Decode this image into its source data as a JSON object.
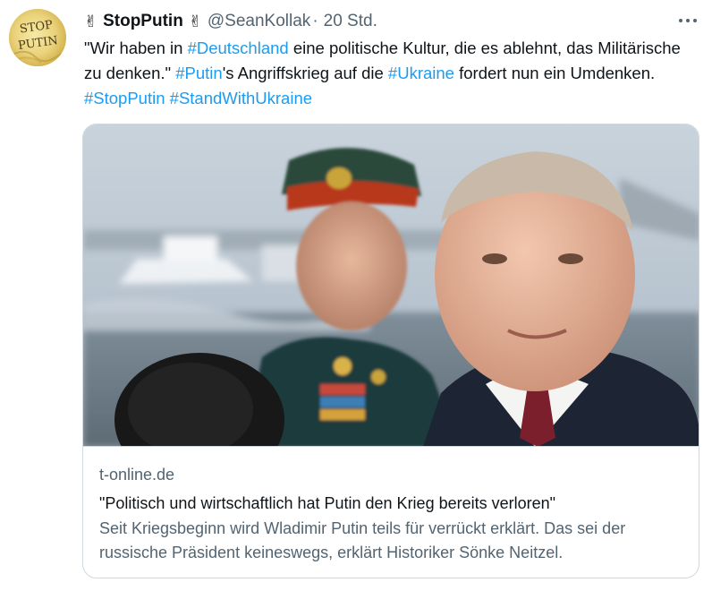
{
  "author": {
    "name": "StopPutin",
    "handle": "@SeanKollak",
    "separator": "·",
    "time": "20 Std.",
    "emoji_left": "✌",
    "emoji_right": "✌",
    "avatar_text": [
      "STOP",
      "PUTIN"
    ]
  },
  "tweet": {
    "p1": "\"Wir haben in ",
    "tag_deutschland": "#Deutschland",
    "p2": " eine politische Kultur, die es ablehnt, das Militärische zu denken.\" ",
    "tag_putin": "#Putin",
    "p3": "'s Angriffskrieg auf die ",
    "tag_ukraine": "#Ukraine",
    "p4": " fordert nun ein Umdenken. ",
    "tag_stopputin": "#StopPutin",
    "p5": " ",
    "tag_standwithukraine": "#StandWithUkraine"
  },
  "card": {
    "domain": "t-online.de",
    "title": "\"Politisch und wirtschaftlich hat Putin den Krieg bereits verloren\"",
    "description": "Seit Kriegsbeginn wird Wladimir Putin teils für verrückt erklärt. Das sei der russische Präsident keineswegs, erklärt Historiker Sönke Neitzel."
  },
  "colors": {
    "accent": "#1d9bf0",
    "text": "#0f1419",
    "secondary": "#536471",
    "border": "#cfd9de"
  },
  "icons": {
    "more": "more-icon"
  }
}
